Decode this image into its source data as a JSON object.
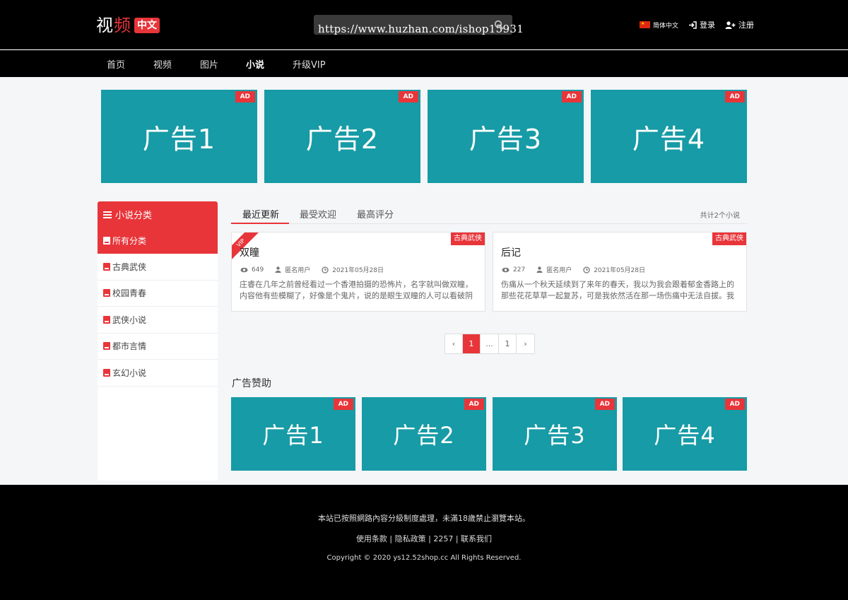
{
  "header": {
    "logo_main": "视",
    "logo_accent": "频",
    "logo_badge": "中文",
    "search_placeholder": "",
    "watermark": "https://www.huzhan.com/ishop15931",
    "language": "简体中文",
    "login": "登录",
    "register": "注册"
  },
  "nav": [
    "首页",
    "视频",
    "图片",
    "小说",
    "升级VIP"
  ],
  "nav_active": "小说",
  "top_ads": [
    {
      "tag": "AD",
      "label": "广告1"
    },
    {
      "tag": "AD",
      "label": "广告2"
    },
    {
      "tag": "AD",
      "label": "广告3"
    },
    {
      "tag": "AD",
      "label": "广告4"
    }
  ],
  "sidebar": {
    "heading": "小说分类",
    "all": "所有分类",
    "items": [
      "古典武侠",
      "校园青春",
      "武侠小说",
      "都市言情",
      "玄幻小说"
    ]
  },
  "tabs": {
    "items": [
      "最近更新",
      "最受欢迎",
      "最高评分"
    ],
    "count": "共计2个小说"
  },
  "novels": [
    {
      "badge": "古典武侠",
      "vip": "VIP",
      "title": "双瞳",
      "views": "649",
      "author": "匿名用户",
      "date": "2021年05月28日",
      "desc": "庄睿在几年之前曾经看过一个香港拍摄的恐怖片，名字就叫做双瞳，内容他有些模糊了，好像是个鬼片，说的是眼生双瞳的人可以看破阴"
    },
    {
      "badge": "古典武侠",
      "vip": "",
      "title": "后记",
      "views": "227",
      "author": "匿名用户",
      "date": "2021年05月28日",
      "desc": "伤痛从一个秋天延续到了来年的春天，我以为我会跟着郁金香路上的那些花花草草一起复苏，可是我依然活在那一场伤痛中无法自拔。我"
    }
  ],
  "pagination": {
    "prev": "‹",
    "current": "1",
    "ellipsis": "...",
    "last": "1",
    "next": "›"
  },
  "sponsor": {
    "title": "广告赞助",
    "ads": [
      {
        "tag": "AD",
        "label": "广告1"
      },
      {
        "tag": "AD",
        "label": "广告2"
      },
      {
        "tag": "AD",
        "label": "广告3"
      },
      {
        "tag": "AD",
        "label": "广告4"
      }
    ]
  },
  "footer": {
    "notice": "本站已按照網路內容分級制度處理，未滿18歲禁止瀏覽本站。",
    "links": [
      "使用条款",
      "隐私政策",
      "2257",
      "联系我们"
    ],
    "copyright": "Copyright © 2020 ys12.52shop.cc All Rights Reserved."
  },
  "colors": {
    "accent": "#e8353a",
    "ad_bg": "#179ba6",
    "header_bg": "#000000"
  }
}
